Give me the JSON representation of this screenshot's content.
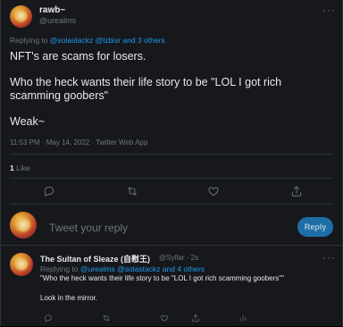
{
  "tweet": {
    "name": "rawb~",
    "handle": "@urealms",
    "replying_prefix": "Replying to ",
    "replying_mentions": "@solastackz @lzbisr",
    "replying_suffix": " and 3 others",
    "text_line1": "NFT's are scams for losers.",
    "text_line2": "Who the heck wants their life story to be \"LOL I got rich",
    "text_line3": "scamming goobers\"",
    "text_line4": "Weak~",
    "meta": "11:53 PM · May 14, 2022 · Twitter Web App",
    "like_count": "1",
    "like_label": "Like"
  },
  "compose": {
    "placeholder": "Tweet your reply",
    "reply_button": "Reply"
  },
  "reply": {
    "name": "The Sultan of Sleaze (自慰王)",
    "handle_time": "@Sylfar · 2s",
    "replying_prefix": "Replying to ",
    "replying_mentions": "@urealms @solastackz",
    "replying_suffix": " and 4 others",
    "text_line1": "\"Who the heck wants their life story to be \"LOL I got rich scamming goobers\"\"",
    "text_line2": "Look in the mirror."
  },
  "icons": {
    "more": "more-horizontal-icon",
    "reply": "reply-icon",
    "retweet": "retweet-icon",
    "like": "heart-icon",
    "share": "share-icon",
    "analytics": "analytics-icon"
  },
  "colors": {
    "background": "#16181c",
    "text": "#e7e9ea",
    "muted": "#71767b",
    "accent": "#1d9bf0"
  }
}
